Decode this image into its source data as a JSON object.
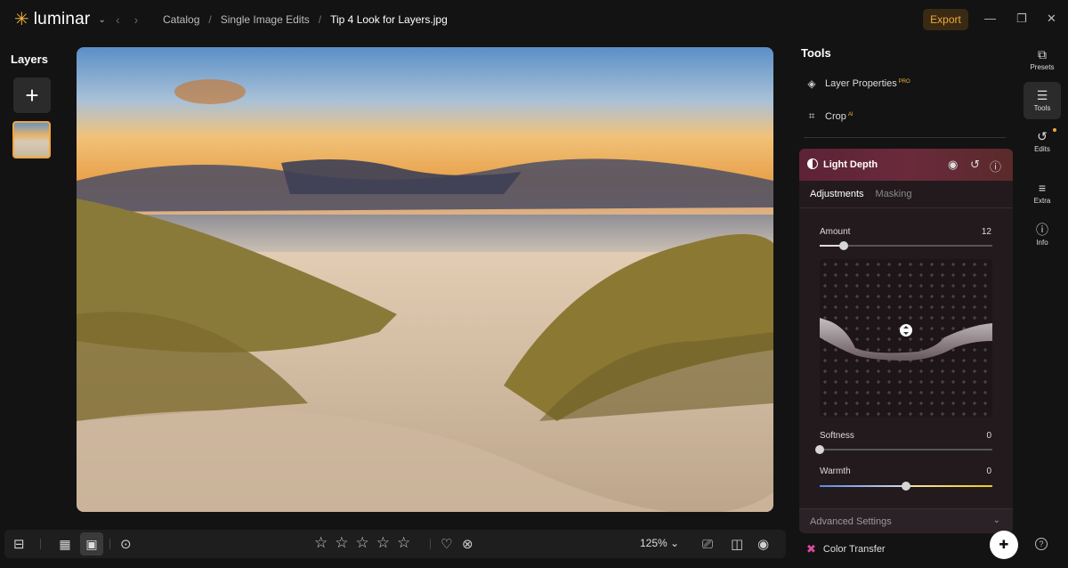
{
  "app": {
    "logo_text": "luminar",
    "accent": "#f2a63a"
  },
  "breadcrumb": [
    "Catalog",
    "Single Image Edits",
    "Tip 4 Look for Layers.jpg"
  ],
  "header": {
    "export_label": "Export"
  },
  "layers": {
    "title": "Layers",
    "add_label": "+"
  },
  "tools": {
    "title": "Tools",
    "items": [
      {
        "label": "Layer Properties",
        "badge": "PRO",
        "icon": "layers-icon"
      },
      {
        "label": "Crop",
        "badge": "AI",
        "icon": "crop-icon"
      }
    ]
  },
  "light_depth": {
    "title": "Light Depth",
    "tabs": [
      "Adjustments",
      "Masking"
    ],
    "amount": {
      "label": "Amount",
      "value": "12",
      "fraction": 0.14
    },
    "softness": {
      "label": "Softness",
      "value": "0",
      "fraction": 0.0
    },
    "warmth": {
      "label": "Warmth",
      "value": "0",
      "fraction": 0.5
    },
    "advanced_label": "Advanced Settings"
  },
  "color_transfer": {
    "label": "Color Transfer"
  },
  "rail": [
    {
      "label": "Presets",
      "icon": "presets-icon"
    },
    {
      "label": "Tools",
      "icon": "sliders-icon"
    },
    {
      "label": "Edits",
      "icon": "history-icon"
    },
    {
      "label": "Extra",
      "icon": "list-icon"
    },
    {
      "label": "Info",
      "icon": "info-icon"
    }
  ],
  "bottom": {
    "zoom": "125%"
  }
}
